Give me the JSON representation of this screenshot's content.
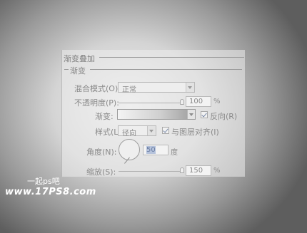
{
  "fieldset": {
    "title": "渐变叠加"
  },
  "group": {
    "title": "渐变"
  },
  "blend_mode": {
    "label": "混合模式(O):",
    "value": "正常"
  },
  "opacity": {
    "label": "不透明度(P):",
    "value": "100",
    "unit": "%",
    "level": 1.0
  },
  "gradient": {
    "label": "渐变:",
    "reverse_label": "反向(R)",
    "reverse_checked": true
  },
  "style": {
    "label": "样式(L):",
    "value": "径向",
    "align_label": "与图层对齐(I)",
    "align_checked": true
  },
  "angle": {
    "label": "角度(N):",
    "value": "50",
    "unit": "度"
  },
  "scale": {
    "label": "缩放(S):",
    "value": "150",
    "unit": "%",
    "level": 1.0
  },
  "watermark": {
    "line1": "一起ps吧",
    "line2": "www.17PS8.com"
  }
}
